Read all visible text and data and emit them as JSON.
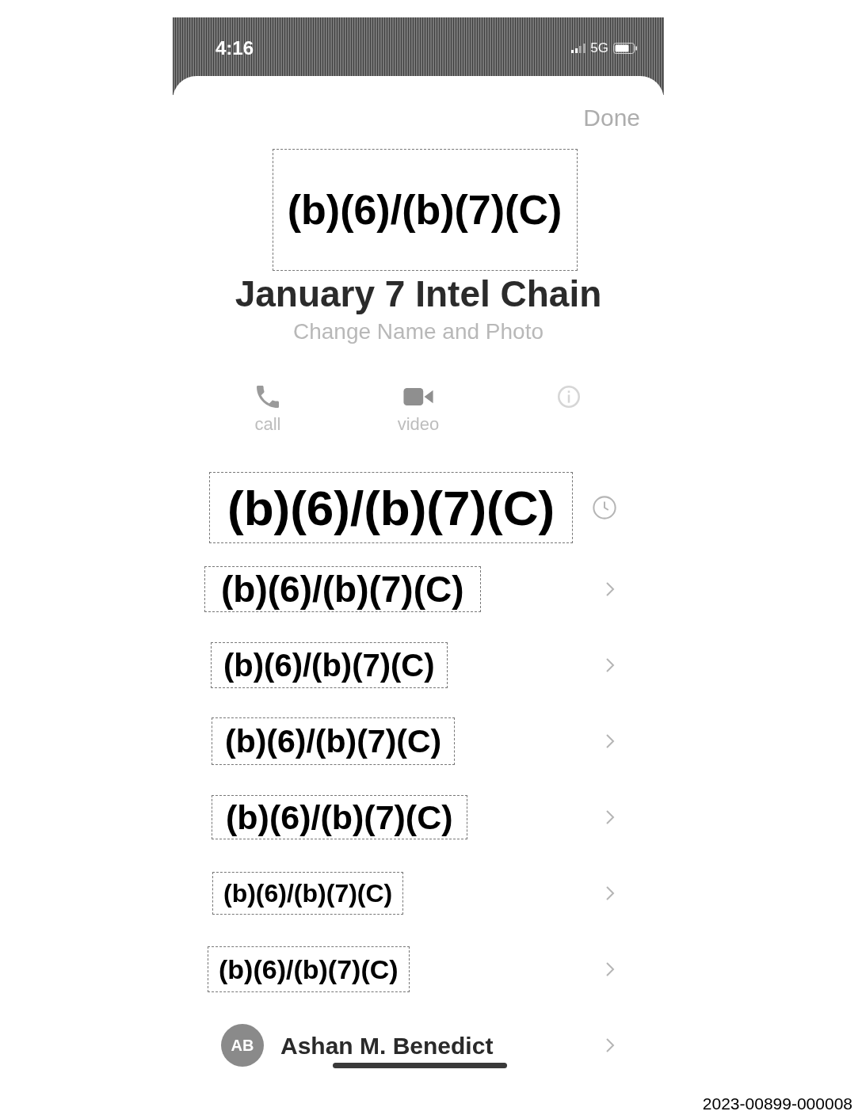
{
  "status_bar": {
    "time": "4:16",
    "network": "5G"
  },
  "header": {
    "done": "Done"
  },
  "group": {
    "photo_redaction": "(b)(6)/(b)(7)(C)",
    "name": "January 7 Intel Chain",
    "edit_link": "Change Name and Photo"
  },
  "actions": [
    {
      "kind": "call",
      "label": "call"
    },
    {
      "kind": "video",
      "label": "video"
    },
    {
      "kind": "info"
    }
  ],
  "members": [
    {
      "kind": "redacted",
      "label": "(b)(6)/(b)(7)(C)",
      "accessory": {
        "kind": "clock"
      }
    },
    {
      "kind": "redacted",
      "label": "(b)(6)/(b)(7)(C)",
      "accessory": {
        "kind": "chevron"
      }
    },
    {
      "kind": "redacted",
      "label": "(b)(6)/(b)(7)(C)",
      "accessory": {
        "kind": "chevron"
      }
    },
    {
      "kind": "redacted",
      "label": "(b)(6)/(b)(7)(C)",
      "accessory": {
        "kind": "chevron"
      }
    },
    {
      "kind": "redacted",
      "label": "(b)(6)/(b)(7)(C)",
      "accessory": {
        "kind": "chevron"
      }
    },
    {
      "kind": "redacted",
      "label": "(b)(6)/(b)(7)(C)",
      "accessory": {
        "kind": "chevron"
      }
    },
    {
      "kind": "redacted",
      "label": "(b)(6)/(b)(7)(C)",
      "accessory": {
        "kind": "chevron"
      }
    },
    {
      "kind": "contact",
      "initials": "AB",
      "name": "Ashan M. Benedict",
      "marked": true,
      "accessory": {
        "kind": "chevron"
      }
    }
  ],
  "footer": {
    "document_number": "2023-00899-000008"
  }
}
